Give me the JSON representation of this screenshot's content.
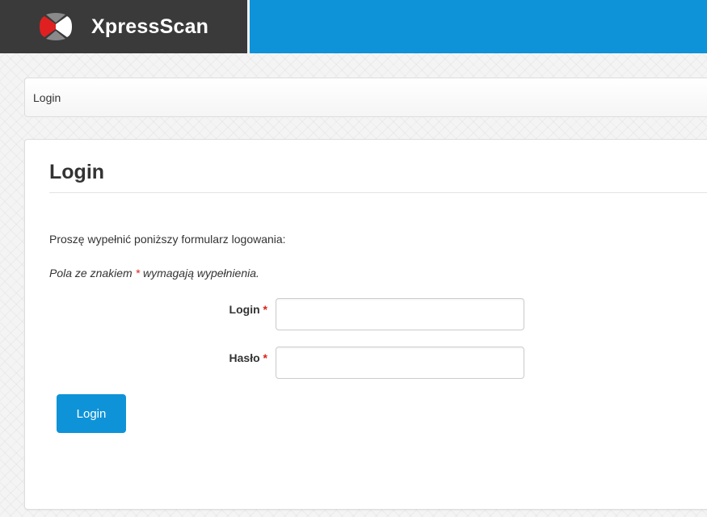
{
  "header": {
    "brand_name": "XpressScan",
    "logo_icon": "xpressscan-logo-icon",
    "colors": {
      "brand_bar": "#3a3a3a",
      "accent": "#0e93d8"
    }
  },
  "breadcrumb": {
    "current": "Login"
  },
  "panel": {
    "title": "Login",
    "intro": "Proszę wypełnić poniższy formularz logowania:",
    "note_before": "Pola ze znakiem",
    "note_star": "*",
    "note_after": "wymagają wypełnienia."
  },
  "form": {
    "login": {
      "label": "Login",
      "required_mark": "*",
      "value": "",
      "placeholder": ""
    },
    "password": {
      "label": "Hasło",
      "required_mark": "*",
      "value": "",
      "placeholder": ""
    },
    "submit_label": "Login"
  },
  "colors": {
    "required": "#d9231b",
    "button": "#0e93d8"
  }
}
